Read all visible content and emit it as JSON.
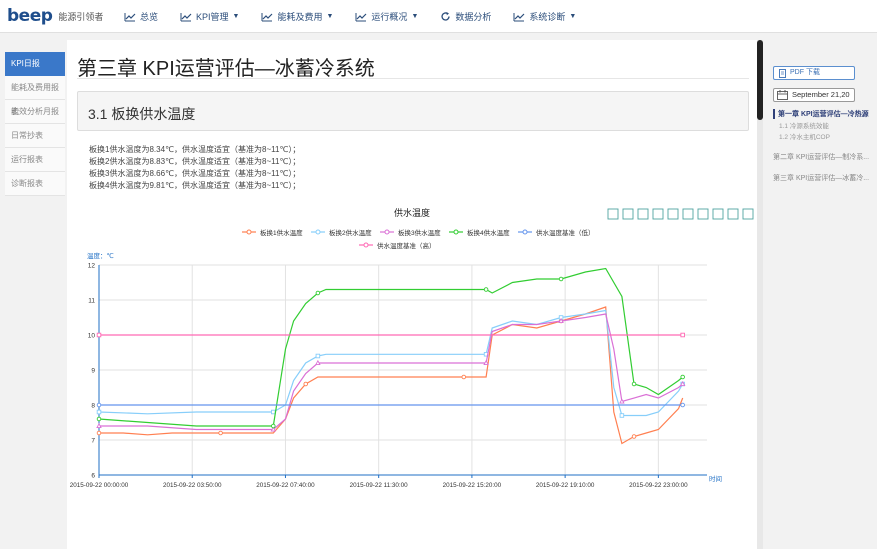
{
  "brand": {
    "logo": "beep",
    "subtitle": "能源引领者"
  },
  "nav": [
    {
      "label": "总览",
      "icon": "chart-line-icon",
      "caret": false
    },
    {
      "label": "KPI管理",
      "icon": "chart-line-icon",
      "caret": true
    },
    {
      "label": "能耗及费用",
      "icon": "chart-line-icon",
      "caret": true
    },
    {
      "label": "运行概况",
      "icon": "chart-line-icon",
      "caret": true
    },
    {
      "label": "数据分析",
      "icon": "refresh-icon",
      "caret": false
    },
    {
      "label": "系统诊断",
      "icon": "chart-line-icon",
      "caret": true
    }
  ],
  "sidebar": [
    {
      "label": "KPI日报",
      "active": true
    },
    {
      "label": "能耗及费用报表",
      "active": false
    },
    {
      "label": "能效分析月报",
      "active": false
    },
    {
      "label": "日常抄表",
      "active": false
    },
    {
      "label": "运行报表",
      "active": false
    },
    {
      "label": "诊断报表",
      "active": false
    }
  ],
  "page": {
    "title": "第三章 KPI运营评估—冰蓄冷系统",
    "section": "3.1 板换供水温度",
    "notes": [
      "板换1供水温度为8.34℃，供水温度适宜（基准为8~11℃）；",
      "板换2供水温度为8.83℃，供水温度适宜（基准为8~11℃）；",
      "板换3供水温度为8.66℃，供水温度适宜（基准为8~11℃）；",
      "板换4供水温度为9.81℃，供水温度适宜（基准为8~11℃）；"
    ]
  },
  "right_panel": {
    "pdf_label": "PDF 下载",
    "date": "September 21,20",
    "toc": [
      {
        "label": "第一章 KPI运营评估—冷热源",
        "active": true,
        "subs": [
          "1.1 冷源系统效能",
          "1.2 冷水主机COP"
        ]
      },
      {
        "label": "第二章 KPI运营评估—制冷系...",
        "active": false,
        "subs": []
      },
      {
        "label": "第三章 KPI运营评估—冰蓄冷...",
        "active": false,
        "subs": []
      }
    ]
  },
  "toolbar_icons": [
    "line-chart-icon",
    "bar-chart-icon",
    "stack-icon",
    "tiled-icon",
    "data-view-icon",
    "mark-pen-icon",
    "mark-undo-icon",
    "mark-clear-icon",
    "restore-icon",
    "save-image-icon"
  ],
  "chart_data": {
    "type": "line",
    "title": "供水温度",
    "ylabel": "温度：℃",
    "xlabel": "时间",
    "ylim": [
      6,
      12
    ],
    "yticks": [
      6,
      7,
      8,
      9,
      10,
      11,
      12
    ],
    "x_range": [
      "2015-09-22 00:00:00",
      "2015-09-23 01:00:00"
    ],
    "xticks": [
      "2015-09-22 00:00:00",
      "2015-09-22 03:50:00",
      "2015-09-22 07:40:00",
      "2015-09-22 11:30:00",
      "2015-09-22 15:20:00",
      "2015-09-22 19:10:00",
      "2015-09-22 23:00:00"
    ],
    "grid": true,
    "legend": "top",
    "series": [
      {
        "name": "板换1供水温度",
        "color": "#ff7f50",
        "marker": "circle",
        "x": [
          "00:00",
          "01:00",
          "02:00",
          "03:00",
          "04:00",
          "05:00",
          "06:00",
          "07:10",
          "07:40",
          "08:00",
          "08:30",
          "09:00",
          "09:20",
          "10:00",
          "12:00",
          "15:00",
          "15:55",
          "16:10",
          "17:00",
          "18:00",
          "19:00",
          "20:00",
          "20:50",
          "21:10",
          "21:30",
          "22:00",
          "22:30",
          "23:00",
          "23:50",
          "24:00"
        ],
        "values": [
          7.2,
          7.2,
          7.15,
          7.2,
          7.2,
          7.2,
          7.2,
          7.2,
          7.6,
          8.2,
          8.6,
          8.8,
          8.8,
          8.8,
          8.8,
          8.8,
          8.8,
          10.0,
          10.3,
          10.2,
          10.4,
          10.6,
          10.8,
          7.8,
          6.9,
          7.1,
          7.2,
          7.3,
          7.9,
          8.2
        ]
      },
      {
        "name": "板换2供水温度",
        "color": "#87cefa",
        "marker": "square",
        "x": [
          "00:00",
          "02:00",
          "04:00",
          "06:00",
          "07:10",
          "07:40",
          "08:00",
          "08:30",
          "09:00",
          "09:20",
          "12:00",
          "15:00",
          "15:55",
          "16:10",
          "17:00",
          "18:00",
          "19:00",
          "20:00",
          "20:50",
          "21:10",
          "21:30",
          "22:30",
          "23:00",
          "23:50",
          "24:00"
        ],
        "values": [
          7.8,
          7.75,
          7.8,
          7.8,
          7.8,
          8.0,
          8.7,
          9.2,
          9.4,
          9.45,
          9.45,
          9.45,
          9.45,
          10.2,
          10.4,
          10.3,
          10.5,
          10.6,
          10.7,
          8.5,
          7.7,
          7.7,
          7.8,
          8.4,
          8.6
        ]
      },
      {
        "name": "板换3供水温度",
        "color": "#da70d6",
        "marker": "triangle",
        "x": [
          "00:00",
          "02:00",
          "04:00",
          "06:00",
          "07:10",
          "07:40",
          "08:00",
          "08:30",
          "09:00",
          "09:20",
          "12:00",
          "15:00",
          "15:55",
          "16:10",
          "17:00",
          "18:00",
          "19:00",
          "20:00",
          "20:50",
          "21:10",
          "21:30",
          "22:30",
          "23:00",
          "23:50",
          "24:00"
        ],
        "values": [
          7.4,
          7.4,
          7.3,
          7.3,
          7.3,
          7.6,
          8.4,
          8.9,
          9.2,
          9.2,
          9.2,
          9.2,
          9.2,
          10.1,
          10.3,
          10.3,
          10.4,
          10.5,
          10.6,
          9.6,
          8.1,
          8.3,
          8.2,
          8.5,
          8.6
        ]
      },
      {
        "name": "板换4供水温度",
        "color": "#32cd32",
        "marker": "circle",
        "x": [
          "00:00",
          "02:00",
          "04:00",
          "06:00",
          "07:10",
          "07:40",
          "08:00",
          "08:30",
          "09:00",
          "09:20",
          "12:00",
          "15:00",
          "15:55",
          "16:10",
          "17:00",
          "18:00",
          "19:00",
          "20:00",
          "20:50",
          "21:30",
          "22:00",
          "22:30",
          "23:00",
          "23:50",
          "24:00"
        ],
        "values": [
          7.6,
          7.5,
          7.4,
          7.4,
          7.4,
          9.6,
          10.4,
          10.9,
          11.2,
          11.3,
          11.3,
          11.3,
          11.3,
          11.2,
          11.5,
          11.6,
          11.6,
          11.8,
          11.9,
          11.1,
          8.6,
          8.5,
          8.3,
          8.7,
          8.8
        ]
      },
      {
        "name": "供水温度基准（低）",
        "color": "#6495ed",
        "marker": "circle",
        "x": [
          "00:00",
          "24:00"
        ],
        "values": [
          8,
          8
        ]
      },
      {
        "name": "供水温度基准（高）",
        "color": "#ff69b4",
        "marker": "square",
        "x": [
          "00:00",
          "24:00"
        ],
        "values": [
          10,
          10
        ]
      }
    ]
  }
}
